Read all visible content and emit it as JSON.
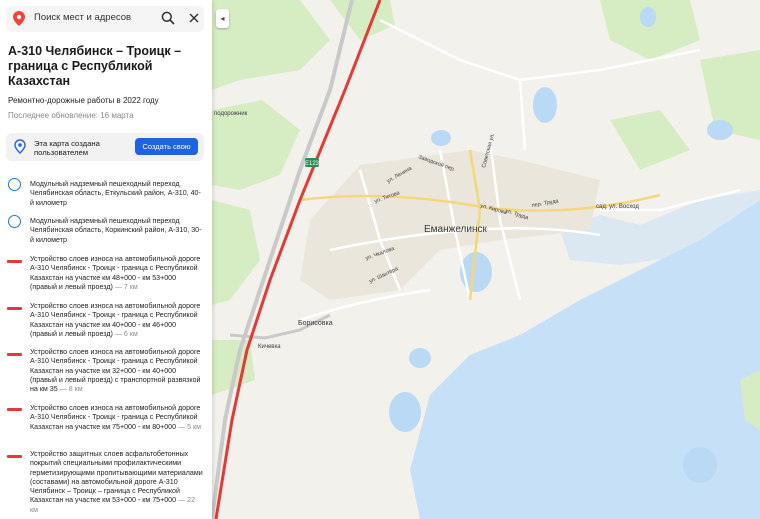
{
  "search": {
    "placeholder": "Поиск мест и адресов"
  },
  "layer": {
    "title": "А-310 Челябинск – Троицк – граница с Республикой Казахстан",
    "subtitle": "Ремонтно-дорожные работы в 2022 году",
    "updated": "Последнее обновление: 16 марта"
  },
  "user_map": {
    "text": "Эта карта создана пользователем",
    "button": "Создать свою"
  },
  "items": [
    {
      "type": "point",
      "text": "Модульный надземный пешеходный переход Челябинская область, Еткульский район, А-310, 40-й километр",
      "length": ""
    },
    {
      "type": "point",
      "text": "Модульный надземный пешеходный переход Челябинская область, Коркинский район, А-310, 30-й километр",
      "length": ""
    },
    {
      "type": "line",
      "text": "Устройство слоев износа на автомобильной дороге А-310 Челябинск - Троицк - граница с Республикой Казахстан на участке км 48+000 - км 53+000 (правый и левый проезд)",
      "length": "— 7 км"
    },
    {
      "type": "line",
      "text": "Устройство слоев износа на автомобильной дороге А-310 Челябинск - Троицк - граница с Республикой Казахстан на участке км 40+000 - км 46+000 (правый и левый проезд)",
      "length": "— 6 км"
    },
    {
      "type": "line",
      "text": "Устройство слоев износа на автомобильной дороге А-310 Челябинск - Троицк - граница с Республикой Казахстан на участке км 32+000 - км 40+000 (правый и левый проезд) с транспортной развязкой на км 35",
      "length": "— 8 км"
    },
    {
      "type": "line",
      "text": "Устройство слоев износа на автомобильной дороге А-310 Челябинск - Троицк - граница с Республикой Казахстан на участке км 75+000 - км 80+000",
      "length": "— 5 км"
    },
    {
      "type": "line",
      "text": "Устройство защитных слоев асфальтобетонных покрытий специальными профилактическими герметизирующими пропитывающими материалами (составами) на автомобильной дороге А-310 Челябинск – Троицк – граница с Республикой Казахстан на участке км 53+000 - км 75+000",
      "length": "— 22 км"
    }
  ],
  "map_labels": {
    "city": "Еманжелинск",
    "borisovka": "Борисовка",
    "kichevka": "Кичевка",
    "podorozhnik": "подорожник",
    "sad": "сад. ул. Восход",
    "road_shield": "Е123",
    "streets": {
      "lenina": "ул. Ленина",
      "titova": "ул. Титова",
      "zavodskoy": "Заводской пер.",
      "sovetskaya": "Советская ул.",
      "chkalova": "ул. Чкалова",
      "shahtera": "ул. Шахтёра",
      "kirova": "ул. Кирова",
      "truda": "ул. Труда",
      "per_truda": "пер. Труда"
    }
  },
  "colors": {
    "accent": "#1e63e0",
    "route": "#e53935",
    "water": "#b9d9f5",
    "forest": "#d4ecc2",
    "point_marker": "#1a73e8"
  }
}
